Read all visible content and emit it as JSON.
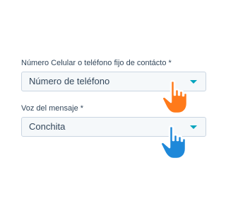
{
  "form": {
    "phone_field": {
      "label": "Número Celular o teléfono fijo de contácto *",
      "value": "Número de teléfono"
    },
    "voice_field": {
      "label": "Voz del mensaje *",
      "value": "Conchita"
    }
  },
  "colors": {
    "input_background": "#f5f8fa",
    "input_border": "#cbd6e2",
    "text": "#33475b",
    "caret": "#00a4bd",
    "hand_cursor_orange": "#ff7a1a",
    "hand_cursor_blue": "#1e88d9"
  },
  "icons": {
    "phone_select_cursor": "pointing-hand-icon",
    "voice_select_cursor": "pointing-hand-icon"
  }
}
